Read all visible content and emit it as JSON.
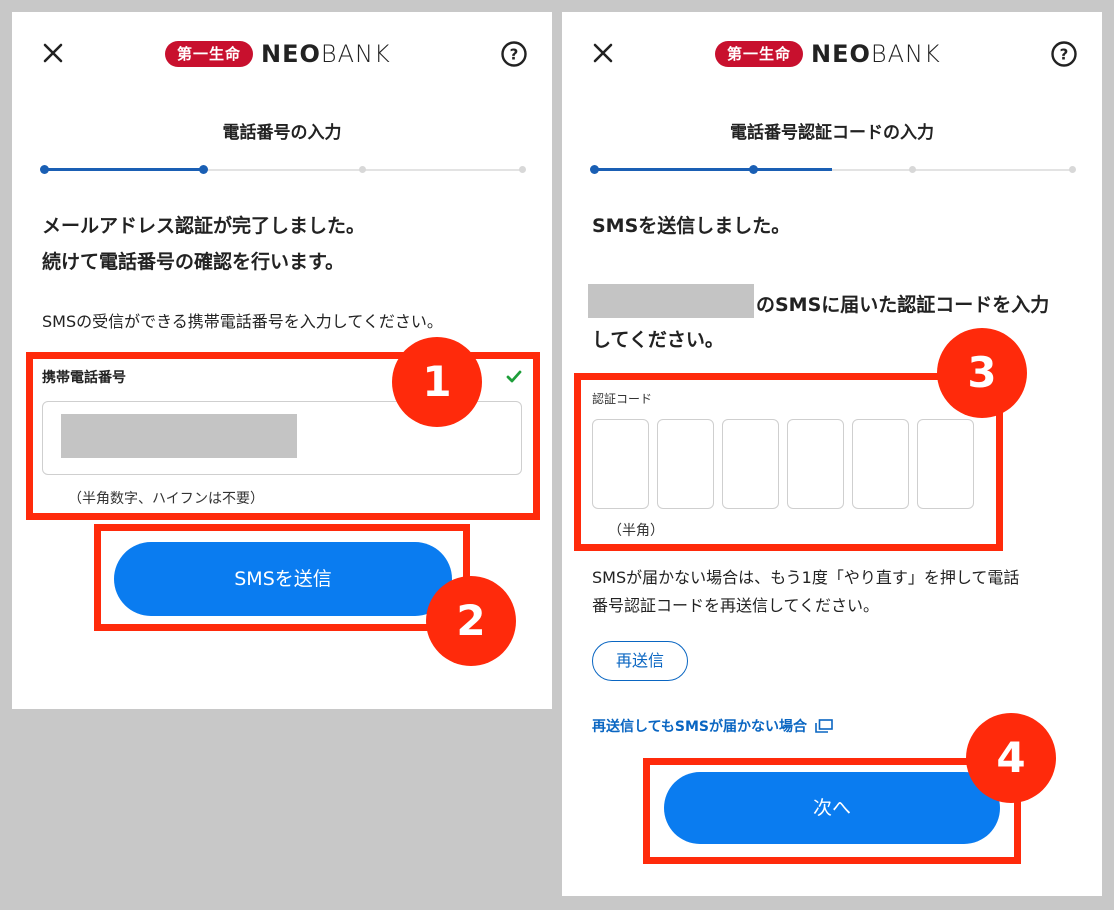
{
  "header": {
    "logo_badge": "第一生命",
    "logo_neo": "NEO",
    "logo_bank": "BANK"
  },
  "left": {
    "step_title": "電話番号の入力",
    "progress": {
      "completed_steps": 2,
      "total_steps": 4
    },
    "lead_line1": "メールアドレス認証が完了しました。",
    "lead_line2": "続けて電話番号の確認を行います。",
    "instruction": "SMSの受信ができる携帯電話番号を入力してください。",
    "field_label": "携帯電話番号",
    "field_hint": "（半角数字、ハイフンは不要）",
    "submit_label": "SMSを送信"
  },
  "right": {
    "step_title": "電話番号認証コードの入力",
    "progress": {
      "completed_steps": 2,
      "total_steps": 4
    },
    "lead": "SMSを送信しました。",
    "sent_line1": "のSMSに届いた認証コードを入力",
    "sent_line2": "してください。",
    "code_label": "認証コード",
    "code_hint": "（半角）",
    "code_digits": [
      "",
      "",
      "",
      "",
      "",
      ""
    ],
    "notice_line1": "SMSが届かない場合は、もう1度「やり直す」を押して電話",
    "notice_line2": "番号認証コードを再送信してください。",
    "resend_label": "再送信",
    "help_link": "再送信してもSMSが届かない場合",
    "next_label": "次へ"
  },
  "annotations": [
    "1",
    "2",
    "3",
    "4"
  ],
  "colors": {
    "primary": "#0a7cf0",
    "link": "#0a66c2",
    "progress": "#1a5fb4",
    "highlight": "#ff2a0b",
    "logo_red": "#c8102e",
    "check": "#1e9e3a"
  }
}
